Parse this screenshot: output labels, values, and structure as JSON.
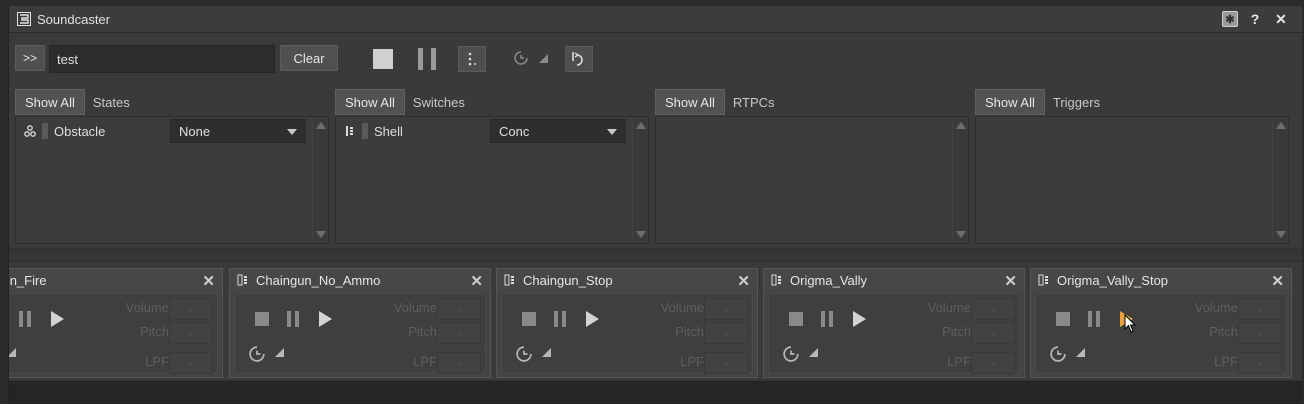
{
  "window": {
    "title": "Soundcaster",
    "controls": {
      "pin": "pin-icon",
      "help": "?",
      "close": "✕"
    }
  },
  "toolbar": {
    "expand_label": ">>",
    "search_value": "test",
    "clear_label": "Clear"
  },
  "panels": [
    {
      "showall": "Show All",
      "label": "States",
      "rows": [
        {
          "name": "Obstacle",
          "value": "None"
        }
      ]
    },
    {
      "showall": "Show All",
      "label": "Switches",
      "rows": [
        {
          "name": "Shell",
          "value": "Conc"
        }
      ]
    },
    {
      "showall": "Show All",
      "label": "RTPCs",
      "rows": []
    },
    {
      "showall": "Show All",
      "label": "Triggers",
      "rows": []
    }
  ],
  "cards": [
    {
      "title": "ngun_Fire",
      "volume_label": "Volume",
      "pitch_label": "Pitch",
      "lpf_label": "LPF",
      "volume": "-",
      "pitch": "-",
      "lpf": "-"
    },
    {
      "title": "Chaingun_No_Ammo",
      "volume_label": "Volume",
      "pitch_label": "Pitch",
      "lpf_label": "LPF",
      "volume": "-",
      "pitch": "-",
      "lpf": "-"
    },
    {
      "title": "Chaingun_Stop",
      "volume_label": "Volume",
      "pitch_label": "Pitch",
      "lpf_label": "LPF",
      "volume": "-",
      "pitch": "-",
      "lpf": "-"
    },
    {
      "title": "Origma_Vally",
      "volume_label": "Volume",
      "pitch_label": "Pitch",
      "lpf_label": "LPF",
      "volume": "-",
      "pitch": "-",
      "lpf": "-"
    },
    {
      "title": "Origma_Vally_Stop",
      "volume_label": "Volume",
      "pitch_label": "Pitch",
      "lpf_label": "LPF",
      "volume": "-",
      "pitch": "-",
      "lpf": "-"
    }
  ],
  "colors": {
    "accent_play": "#e8a33a",
    "background": "#3a3a3a"
  }
}
